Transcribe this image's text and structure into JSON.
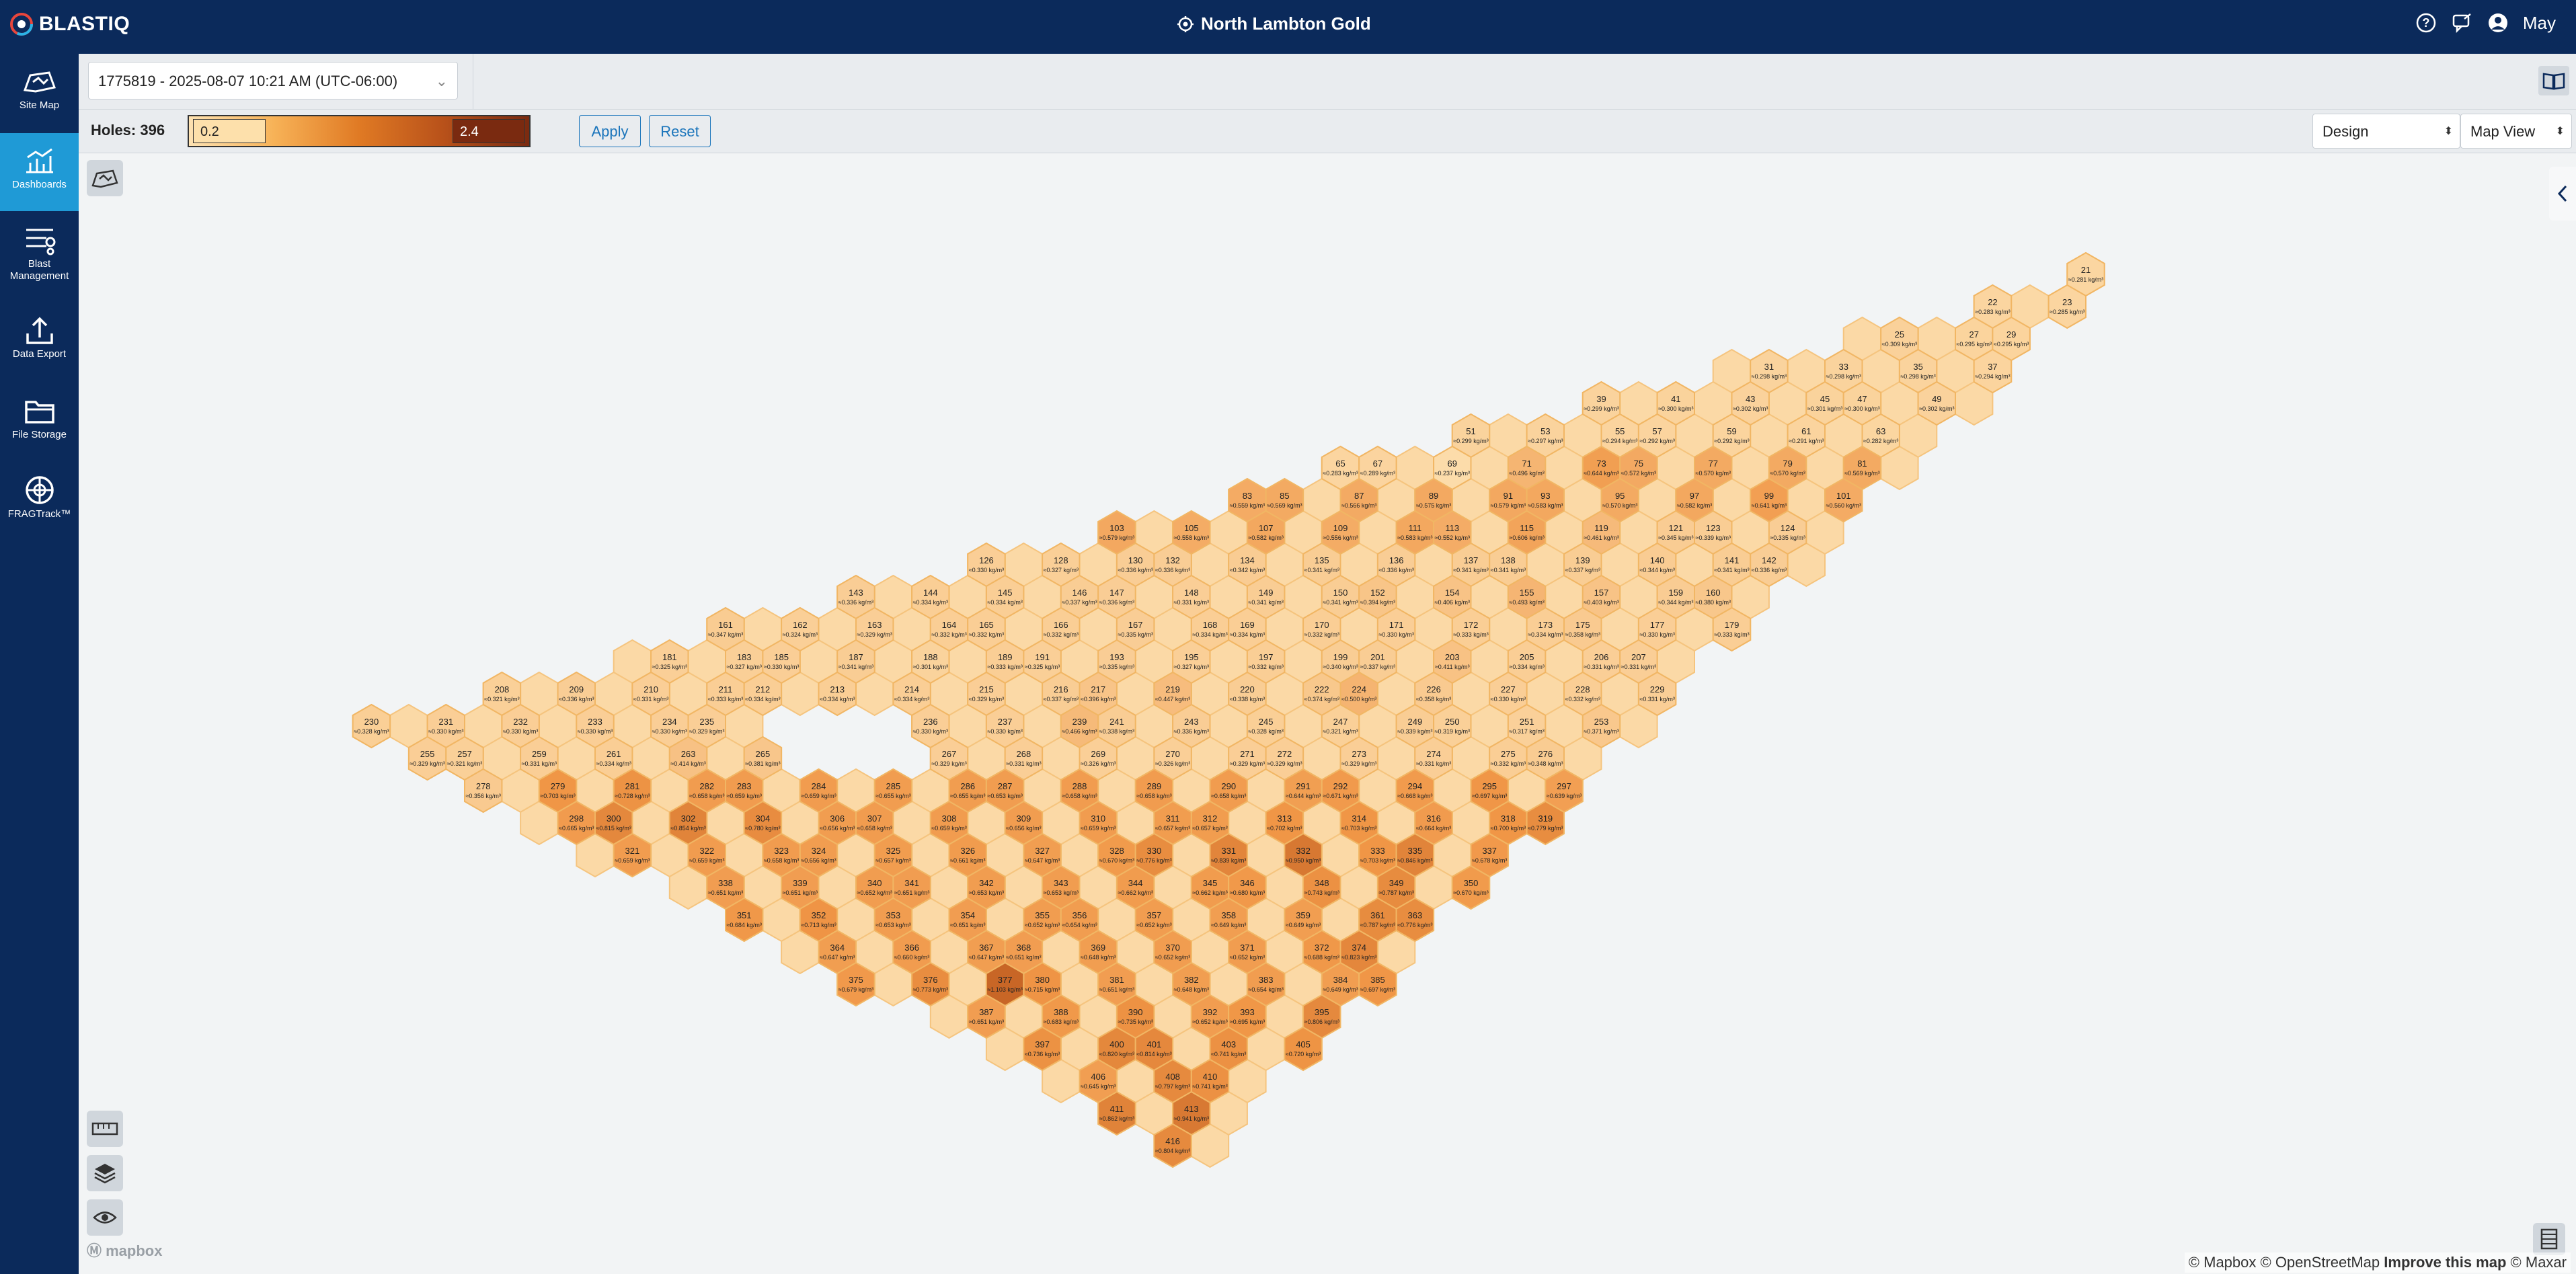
{
  "app": {
    "logo_text": "BLASTIQ",
    "site_name": "North Lambton Gold",
    "user_name": "May"
  },
  "sidebar": {
    "items": [
      {
        "label": "Site Map",
        "icon": "site-map-icon",
        "active": false
      },
      {
        "label": "Dashboards",
        "icon": "dashboard-chart-icon",
        "active": true
      },
      {
        "label": "Blast Management",
        "icon": "blast-management-icon",
        "active": false
      },
      {
        "label": "Data Export",
        "icon": "export-upload-icon",
        "active": false
      },
      {
        "label": "File Storage",
        "icon": "folder-icon",
        "active": false
      },
      {
        "label": "FRAGTrack™",
        "icon": "fragtrack-icon",
        "active": false
      }
    ]
  },
  "controls": {
    "blast_select": "1775819 - 2025-08-07 10:21 AM (UTC-06:00)",
    "holes_label": "Holes: 396",
    "scale_min": "0.2",
    "scale_max": "2.4",
    "apply_label": "Apply",
    "reset_label": "Reset",
    "design_select": "Design",
    "view_select": "Map View"
  },
  "map": {
    "attribution_copyright": "© Mapbox © OpenStreetMap",
    "attribution_improve": "Improve this map",
    "attribution_tail": "© Maxar",
    "mapbox_logo": "mapbox",
    "unit": "kg/m³",
    "holes": [
      {
        "id": "21",
        "value": 0.281
      },
      {
        "id": "22",
        "value": 0.283
      },
      {
        "id": "23",
        "value": 0.285
      },
      {
        "id": "25",
        "value": 0.309
      },
      {
        "id": "27",
        "value": 0.295
      },
      {
        "id": "29",
        "value": 0.295
      },
      {
        "id": "31",
        "value": 0.298
      },
      {
        "id": "33",
        "value": 0.298
      },
      {
        "id": "35",
        "value": 0.298
      },
      {
        "id": "37",
        "value": 0.294
      },
      {
        "id": "39",
        "value": 0.299
      },
      {
        "id": "41",
        "value": 0.3
      },
      {
        "id": "43",
        "value": 0.302
      },
      {
        "id": "45",
        "value": 0.301
      },
      {
        "id": "47",
        "value": 0.3
      },
      {
        "id": "49",
        "value": 0.302
      },
      {
        "id": "51",
        "value": 0.299
      },
      {
        "id": "53",
        "value": 0.297
      },
      {
        "id": "55",
        "value": 0.294
      },
      {
        "id": "57",
        "value": 0.292
      },
      {
        "id": "59",
        "value": 0.292
      },
      {
        "id": "61",
        "value": 0.291
      },
      {
        "id": "63",
        "value": 0.282
      },
      {
        "id": "65",
        "value": 0.283
      },
      {
        "id": "67",
        "value": 0.289
      },
      {
        "id": "69",
        "value": 0.237
      },
      {
        "id": "71",
        "value": 0.496
      },
      {
        "id": "73",
        "value": 0.644
      },
      {
        "id": "75",
        "value": 0.572
      },
      {
        "id": "77",
        "value": 0.57
      },
      {
        "id": "79",
        "value": 0.57
      },
      {
        "id": "81",
        "value": 0.569
      },
      {
        "id": "83",
        "value": 0.559
      },
      {
        "id": "85",
        "value": 0.569
      },
      {
        "id": "87",
        "value": 0.566
      },
      {
        "id": "89",
        "value": 0.575
      },
      {
        "id": "91",
        "value": 0.579
      },
      {
        "id": "93",
        "value": 0.583
      },
      {
        "id": "95",
        "value": 0.57
      },
      {
        "id": "97",
        "value": 0.582
      },
      {
        "id": "99",
        "value": 0.641
      },
      {
        "id": "101",
        "value": 0.56
      },
      {
        "id": "103",
        "value": 0.579
      },
      {
        "id": "105",
        "value": 0.558
      },
      {
        "id": "107",
        "value": 0.582
      },
      {
        "id": "109",
        "value": 0.556
      },
      {
        "id": "111",
        "value": 0.583
      },
      {
        "id": "113",
        "value": 0.552
      },
      {
        "id": "115",
        "value": 0.606
      },
      {
        "id": "119",
        "value": 0.461
      },
      {
        "id": "121",
        "value": 0.345
      },
      {
        "id": "123",
        "value": 0.339
      },
      {
        "id": "124",
        "value": 0.335
      },
      {
        "id": "126",
        "value": 0.33
      },
      {
        "id": "128",
        "value": 0.327
      },
      {
        "id": "130",
        "value": 0.336
      },
      {
        "id": "132",
        "value": 0.336
      },
      {
        "id": "134",
        "value": 0.342
      },
      {
        "id": "135",
        "value": 0.341
      },
      {
        "id": "136",
        "value": 0.336
      },
      {
        "id": "137",
        "value": 0.341
      },
      {
        "id": "138",
        "value": 0.341
      },
      {
        "id": "139",
        "value": 0.337
      },
      {
        "id": "140",
        "value": 0.344
      },
      {
        "id": "141",
        "value": 0.341
      },
      {
        "id": "142",
        "value": 0.336
      },
      {
        "id": "143",
        "value": 0.336
      },
      {
        "id": "144",
        "value": 0.334
      },
      {
        "id": "145",
        "value": 0.334
      },
      {
        "id": "146",
        "value": 0.337
      },
      {
        "id": "147",
        "value": 0.336
      },
      {
        "id": "148",
        "value": 0.331
      },
      {
        "id": "149",
        "value": 0.341
      },
      {
        "id": "150",
        "value": 0.341
      },
      {
        "id": "152",
        "value": 0.394
      },
      {
        "id": "154",
        "value": 0.406
      },
      {
        "id": "155",
        "value": 0.493
      },
      {
        "id": "157",
        "value": 0.403
      },
      {
        "id": "159",
        "value": 0.344
      },
      {
        "id": "160",
        "value": 0.38
      },
      {
        "id": "161",
        "value": 0.347
      },
      {
        "id": "162",
        "value": 0.324
      },
      {
        "id": "163",
        "value": 0.329
      },
      {
        "id": "164",
        "value": 0.332
      },
      {
        "id": "165",
        "value": 0.332
      },
      {
        "id": "166",
        "value": 0.332
      },
      {
        "id": "167",
        "value": 0.335
      },
      {
        "id": "168",
        "value": 0.334
      },
      {
        "id": "169",
        "value": 0.334
      },
      {
        "id": "170",
        "value": 0.332
      },
      {
        "id": "171",
        "value": 0.33
      },
      {
        "id": "172",
        "value": 0.333
      },
      {
        "id": "173",
        "value": 0.334
      },
      {
        "id": "175",
        "value": 0.358
      },
      {
        "id": "177",
        "value": 0.33
      },
      {
        "id": "179",
        "value": 0.333
      },
      {
        "id": "181",
        "value": 0.325
      },
      {
        "id": "183",
        "value": 0.327
      },
      {
        "id": "185",
        "value": 0.33
      },
      {
        "id": "187",
        "value": 0.341
      },
      {
        "id": "188",
        "value": 0.301
      },
      {
        "id": "189",
        "value": 0.333
      },
      {
        "id": "191",
        "value": 0.325
      },
      {
        "id": "193",
        "value": 0.335
      },
      {
        "id": "195",
        "value": 0.327
      },
      {
        "id": "197",
        "value": 0.332
      },
      {
        "id": "199",
        "value": 0.34
      },
      {
        "id": "201",
        "value": 0.337
      },
      {
        "id": "203",
        "value": 0.411
      },
      {
        "id": "205",
        "value": 0.334
      },
      {
        "id": "206",
        "value": 0.331
      },
      {
        "id": "207",
        "value": 0.331
      },
      {
        "id": "208",
        "value": 0.321
      },
      {
        "id": "209",
        "value": 0.336
      },
      {
        "id": "210",
        "value": 0.331
      },
      {
        "id": "211",
        "value": 0.333
      },
      {
        "id": "212",
        "value": 0.334
      },
      {
        "id": "213",
        "value": 0.334
      },
      {
        "id": "214",
        "value": 0.334
      },
      {
        "id": "215",
        "value": 0.329
      },
      {
        "id": "216",
        "value": 0.337
      },
      {
        "id": "217",
        "value": 0.396
      },
      {
        "id": "219",
        "value": 0.447
      },
      {
        "id": "220",
        "value": 0.338
      },
      {
        "id": "222",
        "value": 0.374
      },
      {
        "id": "224",
        "value": 0.5
      },
      {
        "id": "226",
        "value": 0.358
      },
      {
        "id": "227",
        "value": 0.33
      },
      {
        "id": "228",
        "value": 0.332
      },
      {
        "id": "229",
        "value": 0.331
      },
      {
        "id": "230",
        "value": 0.328
      },
      {
        "id": "231",
        "value": 0.33
      },
      {
        "id": "232",
        "value": 0.33
      },
      {
        "id": "233",
        "value": 0.33
      },
      {
        "id": "234",
        "value": 0.33
      },
      {
        "id": "235",
        "value": 0.329
      },
      {
        "id": "236",
        "value": 0.33
      },
      {
        "id": "237",
        "value": 0.33
      },
      {
        "id": "239",
        "value": 0.466
      },
      {
        "id": "241",
        "value": 0.338
      },
      {
        "id": "243",
        "value": 0.336
      },
      {
        "id": "245",
        "value": 0.328
      },
      {
        "id": "247",
        "value": 0.321
      },
      {
        "id": "249",
        "value": 0.339
      },
      {
        "id": "250",
        "value": 0.319
      },
      {
        "id": "251",
        "value": 0.317
      },
      {
        "id": "253",
        "value": 0.371
      },
      {
        "id": "255",
        "value": 0.329
      },
      {
        "id": "257",
        "value": 0.321
      },
      {
        "id": "259",
        "value": 0.331
      },
      {
        "id": "261",
        "value": 0.334
      },
      {
        "id": "263",
        "value": 0.414
      },
      {
        "id": "265",
        "value": 0.381
      },
      {
        "id": "267",
        "value": 0.329
      },
      {
        "id": "268",
        "value": 0.331
      },
      {
        "id": "269",
        "value": 0.326
      },
      {
        "id": "270",
        "value": 0.326
      },
      {
        "id": "271",
        "value": 0.329
      },
      {
        "id": "272",
        "value": 0.329
      },
      {
        "id": "273",
        "value": 0.329
      },
      {
        "id": "274",
        "value": 0.331
      },
      {
        "id": "275",
        "value": 0.332
      },
      {
        "id": "276",
        "value": 0.348
      },
      {
        "id": "278",
        "value": 0.356
      },
      {
        "id": "279",
        "value": 0.703
      },
      {
        "id": "281",
        "value": 0.728
      },
      {
        "id": "282",
        "value": 0.658
      },
      {
        "id": "283",
        "value": 0.659
      },
      {
        "id": "284",
        "value": 0.659
      },
      {
        "id": "285",
        "value": 0.655
      },
      {
        "id": "286",
        "value": 0.655
      },
      {
        "id": "287",
        "value": 0.653
      },
      {
        "id": "288",
        "value": 0.658
      },
      {
        "id": "289",
        "value": 0.658
      },
      {
        "id": "290",
        "value": 0.658
      },
      {
        "id": "291",
        "value": 0.644
      },
      {
        "id": "292",
        "value": 0.671
      },
      {
        "id": "294",
        "value": 0.668
      },
      {
        "id": "295",
        "value": 0.697
      },
      {
        "id": "297",
        "value": 0.639
      },
      {
        "id": "298",
        "value": 0.665
      },
      {
        "id": "300",
        "value": 0.815
      },
      {
        "id": "302",
        "value": 0.854
      },
      {
        "id": "304",
        "value": 0.78
      },
      {
        "id": "306",
        "value": 0.656
      },
      {
        "id": "307",
        "value": 0.658
      },
      {
        "id": "308",
        "value": 0.659
      },
      {
        "id": "309",
        "value": 0.656
      },
      {
        "id": "310",
        "value": 0.659
      },
      {
        "id": "311",
        "value": 0.657
      },
      {
        "id": "312",
        "value": 0.657
      },
      {
        "id": "313",
        "value": 0.702
      },
      {
        "id": "314",
        "value": 0.703
      },
      {
        "id": "316",
        "value": 0.664
      },
      {
        "id": "318",
        "value": 0.7
      },
      {
        "id": "319",
        "value": 0.779
      },
      {
        "id": "321",
        "value": 0.659
      },
      {
        "id": "322",
        "value": 0.659
      },
      {
        "id": "323",
        "value": 0.658
      },
      {
        "id": "324",
        "value": 0.656
      },
      {
        "id": "325",
        "value": 0.657
      },
      {
        "id": "326",
        "value": 0.661
      },
      {
        "id": "327",
        "value": 0.647
      },
      {
        "id": "328",
        "value": 0.67
      },
      {
        "id": "330",
        "value": 0.776
      },
      {
        "id": "331",
        "value": 0.839
      },
      {
        "id": "332",
        "value": 0.95
      },
      {
        "id": "333",
        "value": 0.703
      },
      {
        "id": "335",
        "value": 0.846
      },
      {
        "id": "337",
        "value": 0.678
      },
      {
        "id": "338",
        "value": 0.651
      },
      {
        "id": "339",
        "value": 0.651
      },
      {
        "id": "340",
        "value": 0.652
      },
      {
        "id": "341",
        "value": 0.651
      },
      {
        "id": "342",
        "value": 0.653
      },
      {
        "id": "343",
        "value": 0.653
      },
      {
        "id": "344",
        "value": 0.662
      },
      {
        "id": "345",
        "value": 0.662
      },
      {
        "id": "346",
        "value": 0.68
      },
      {
        "id": "348",
        "value": 0.743
      },
      {
        "id": "349",
        "value": 0.787
      },
      {
        "id": "350",
        "value": 0.67
      },
      {
        "id": "351",
        "value": 0.684
      },
      {
        "id": "352",
        "value": 0.713
      },
      {
        "id": "353",
        "value": 0.653
      },
      {
        "id": "354",
        "value": 0.651
      },
      {
        "id": "355",
        "value": 0.652
      },
      {
        "id": "356",
        "value": 0.654
      },
      {
        "id": "357",
        "value": 0.652
      },
      {
        "id": "358",
        "value": 0.649
      },
      {
        "id": "359",
        "value": 0.649
      },
      {
        "id": "361",
        "value": 0.787
      },
      {
        "id": "363",
        "value": 0.776
      },
      {
        "id": "364",
        "value": 0.647
      },
      {
        "id": "366",
        "value": 0.66
      },
      {
        "id": "367",
        "value": 0.647
      },
      {
        "id": "368",
        "value": 0.651
      },
      {
        "id": "369",
        "value": 0.648
      },
      {
        "id": "370",
        "value": 0.652
      },
      {
        "id": "371",
        "value": 0.652
      },
      {
        "id": "372",
        "value": 0.688
      },
      {
        "id": "374",
        "value": 0.823
      },
      {
        "id": "375",
        "value": 0.679
      },
      {
        "id": "376",
        "value": 0.773
      },
      {
        "id": "377",
        "value": 1.103
      },
      {
        "id": "380",
        "value": 0.715
      },
      {
        "id": "381",
        "value": 0.651
      },
      {
        "id": "382",
        "value": 0.648
      },
      {
        "id": "383",
        "value": 0.654
      },
      {
        "id": "384",
        "value": 0.649
      },
      {
        "id": "385",
        "value": 0.697
      },
      {
        "id": "387",
        "value": 0.651
      },
      {
        "id": "388",
        "value": 0.683
      },
      {
        "id": "390",
        "value": 0.735
      },
      {
        "id": "392",
        "value": 0.652
      },
      {
        "id": "393",
        "value": 0.695
      },
      {
        "id": "395",
        "value": 0.806
      },
      {
        "id": "397",
        "value": 0.736
      },
      {
        "id": "400",
        "value": 0.82
      },
      {
        "id": "401",
        "value": 0.814
      },
      {
        "id": "403",
        "value": 0.741
      },
      {
        "id": "405",
        "value": 0.72
      },
      {
        "id": "406",
        "value": 0.645
      },
      {
        "id": "408",
        "value": 0.797
      },
      {
        "id": "410",
        "value": 0.741
      },
      {
        "id": "411",
        "value": 0.862
      },
      {
        "id": "413",
        "value": 0.941
      },
      {
        "id": "416",
        "value": 0.804
      }
    ]
  }
}
